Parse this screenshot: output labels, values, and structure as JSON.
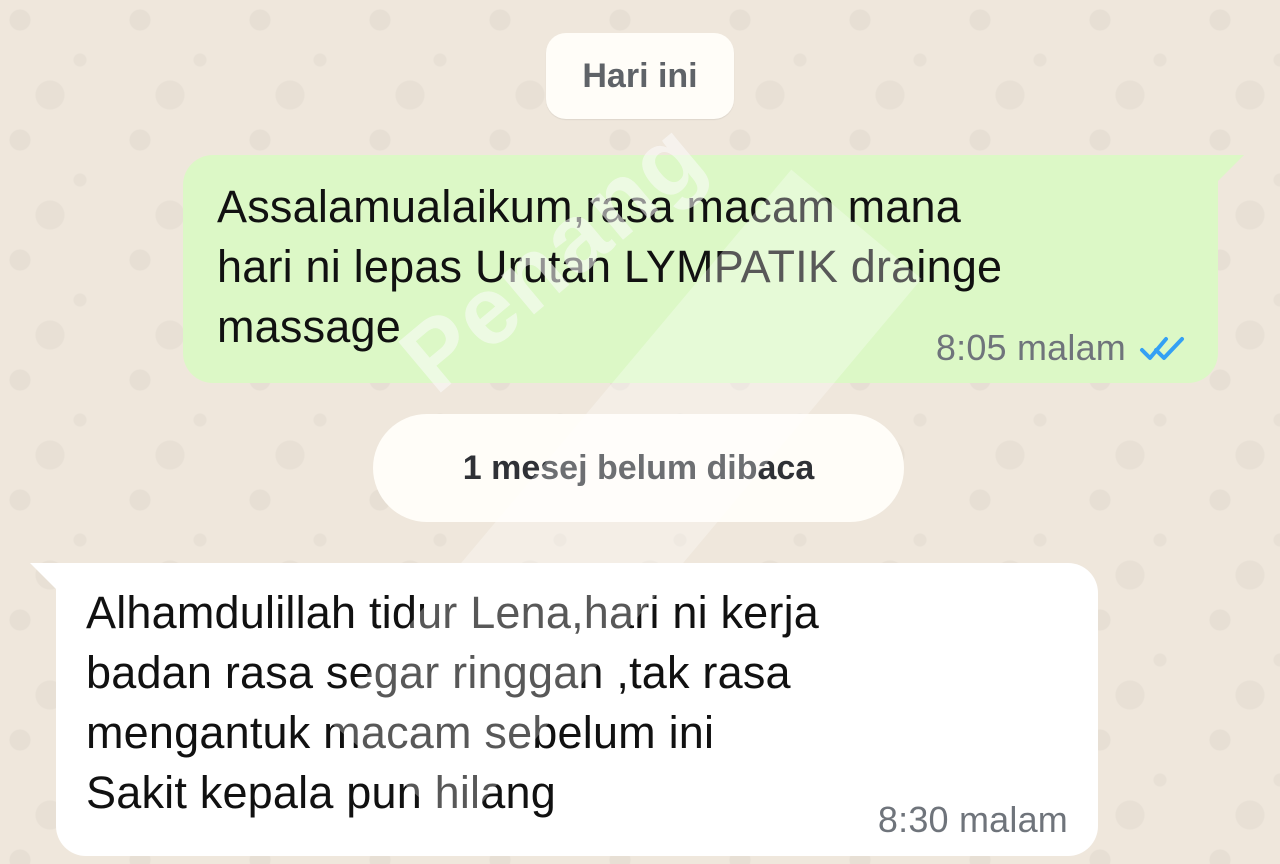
{
  "chat": {
    "date_label": "Hari ini",
    "unread_label": "1 mesej belum dibaca",
    "messages": [
      {
        "direction": "outgoing",
        "text": "Assalamualaikum,rasa macam mana\nhari ni lepas Urutan LYMPATIK drainge\nmassage",
        "time": "8:05 malam",
        "status_icon": "double-check-read-icon"
      },
      {
        "direction": "incoming",
        "text": "Alhamdulillah tidur Lena,hari ni kerja\nbadan rasa segar ringgan ,tak rasa\nmengantuk macam sebelum ini\nSakit kepala pun hilang",
        "time": "8:30 malam"
      }
    ],
    "watermark": "Penang"
  },
  "colors": {
    "wallpaper": "#efe7dc",
    "outgoing_bubble": "#dcf8c6",
    "incoming_bubble": "#ffffff",
    "read_receipt": "#34a0f4"
  }
}
